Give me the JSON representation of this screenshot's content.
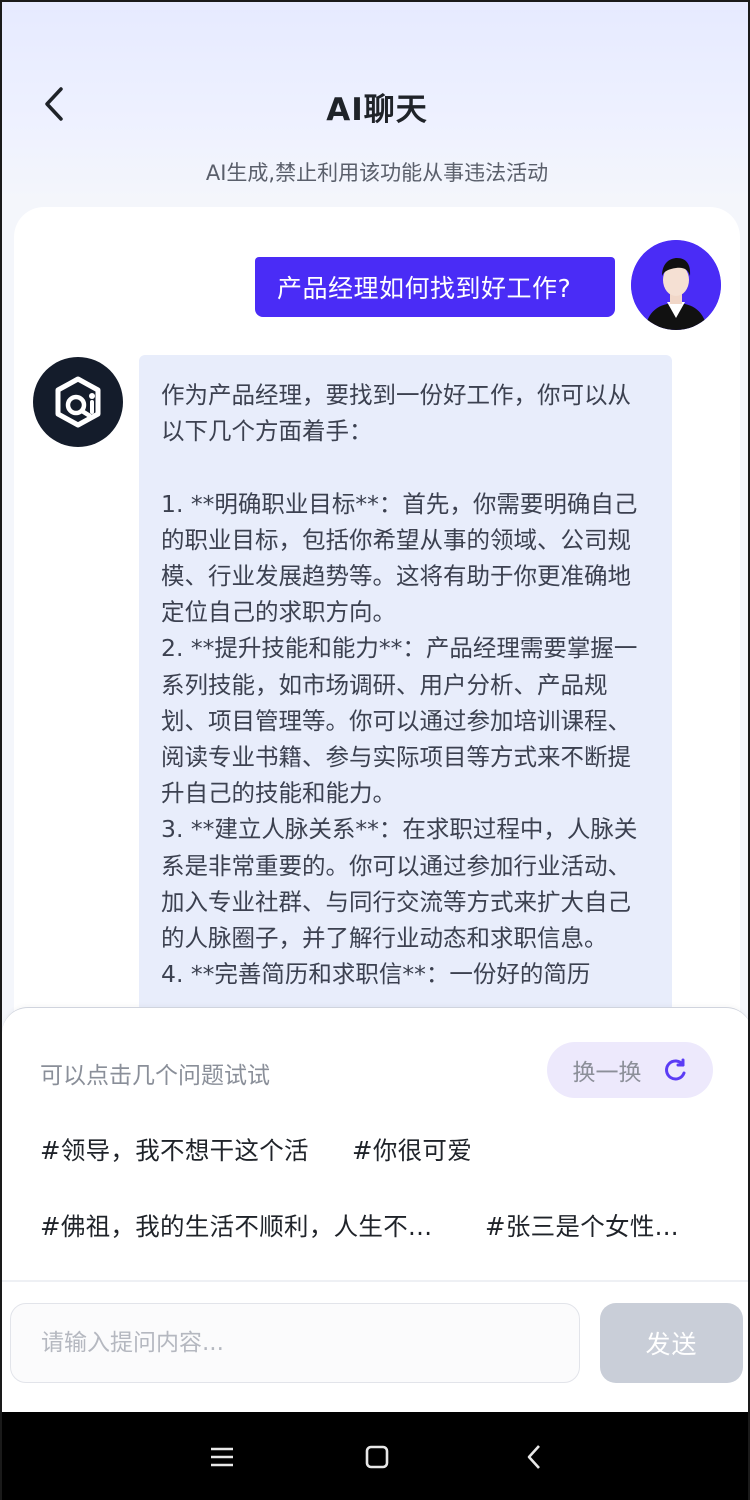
{
  "header": {
    "title": "AI聊天",
    "subtitle": "AI生成,禁止利用该功能从事违法活动",
    "back_icon": "chevron-left-icon"
  },
  "chat": {
    "user_message": "产品经理如何找到好工作?",
    "ai_message": "作为产品经理，要找到一份好工作，你可以从以下几个方面着手：\n\n1. **明确职业目标**：首先，你需要明确自己的职业目标，包括你希望从事的领域、公司规模、行业发展趋势等。这将有助于你更准确地定位自己的求职方向。\n2. **提升技能和能力**：产品经理需要掌握一系列技能，如市场调研、用户分析、产品规划、项目管理等。你可以通过参加培训课程、阅读专业书籍、参与实际项目等方式来不断提升自己的技能和能力。\n3. **建立人脉关系**：在求职过程中，人脉关系是非常重要的。你可以通过参加行业活动、加入专业社群、与同行交流等方式来扩大自己的人脉圈子，并了解行业动态和求职信息。\n4. **完善简历和求职信**：一份好的简历"
  },
  "suggestions": {
    "hint": "可以点击几个问题试试",
    "swap_label": "换一换",
    "swap_icon": "refresh-icon",
    "topics": [
      "#领导，我不想干这个活",
      "#你很可爱",
      "#佛祖，我的生活不顺利，人生不...",
      "#张三是个女性..."
    ]
  },
  "composer": {
    "placeholder": "请输入提问内容...",
    "send_label": "发送"
  },
  "colors": {
    "accent": "#4a2cf6",
    "ai_bubble": "#e8edfb",
    "send_disabled": "#c9ced8",
    "swap_bg": "#ede9fc"
  }
}
